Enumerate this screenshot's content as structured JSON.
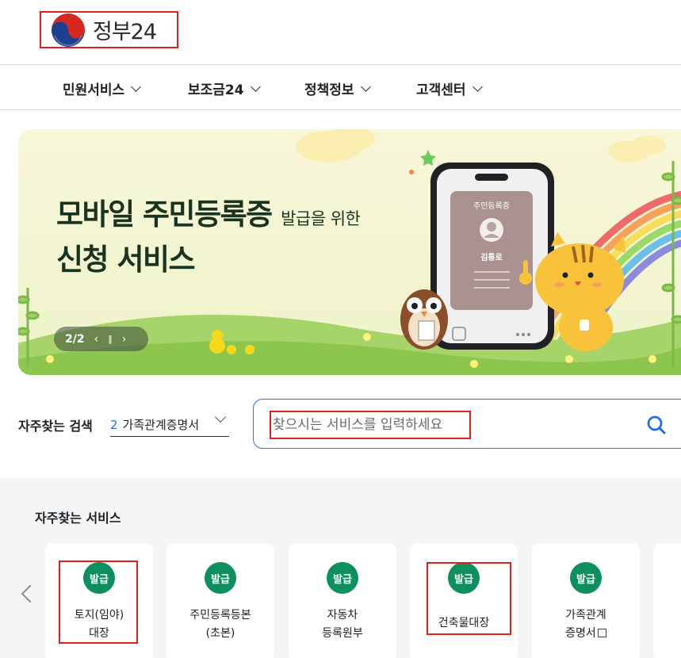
{
  "header": {
    "logo_text": "정부24",
    "logo_icon": "taegeuk-icon"
  },
  "nav": {
    "items": [
      {
        "label": "민원서비스"
      },
      {
        "label": "보조금24"
      },
      {
        "label": "정책정보"
      },
      {
        "label": "고객센터"
      }
    ]
  },
  "banner": {
    "title_line1": "모바일 주민등록증",
    "title_line1_small": "발급을 위한",
    "title_line2": "신청 서비스",
    "card_title": "주민등록증",
    "card_name": "김통로",
    "pager": "2/2",
    "prev_icon": "chevron-left-icon",
    "pause_icon": "pause-icon",
    "next_icon": "chevron-right-icon"
  },
  "quick_search": {
    "label": "자주찾는 검색",
    "selected_number": "2",
    "selected_text": "가족관계증명서",
    "placeholder": "찾으시는 서비스를 입력하세요",
    "search_icon": "search-icon"
  },
  "services": {
    "title": "자주찾는 서비스",
    "items": [
      {
        "badge": "발급",
        "line1": "토지(임야)",
        "line2": "대장"
      },
      {
        "badge": "발급",
        "line1": "주민등록등본",
        "line2": "(초본)"
      },
      {
        "badge": "발급",
        "line1": "자동차",
        "line2": "등록원부"
      },
      {
        "badge": "발급",
        "line1": "건축물대장",
        "line2": ""
      },
      {
        "badge": "발급",
        "line1": "가족관계",
        "line2": "증명서"
      }
    ]
  },
  "colors": {
    "primary": "#256ef4",
    "badge_green": "#0e8f5e",
    "highlight_red": "#e0201c"
  }
}
